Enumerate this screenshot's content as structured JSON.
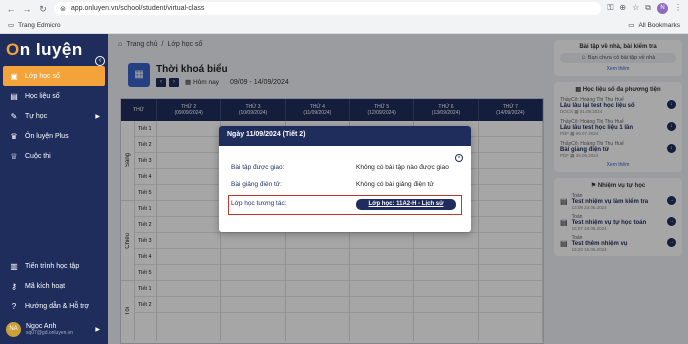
{
  "browser": {
    "url": "app.onluyen.vn/school/student/virtual-class",
    "bookmark": "Trang Edmicro",
    "all_bookmarks": "All Bookmarks",
    "profile_initials": "N"
  },
  "sidebar": {
    "logo_prefix": "O",
    "logo_rest": "n luyện",
    "items": [
      {
        "label": "Lớp học số",
        "icon": "class-icon"
      },
      {
        "label": "Học liệu số",
        "icon": "book-icon"
      },
      {
        "label": "Tự học",
        "icon": "study-icon"
      },
      {
        "label": "Ôn luyện Plus",
        "icon": "trophy-icon"
      },
      {
        "label": "Cuộc thi",
        "icon": "cup-icon"
      }
    ],
    "bottom_items": [
      {
        "label": "Tiến trình học tập",
        "icon": "chart-icon"
      },
      {
        "label": "Mã kích hoạt",
        "icon": "key-icon"
      },
      {
        "label": "Hướng dẫn & Hỗ trợ",
        "icon": "help-icon"
      }
    ],
    "user": {
      "initials": "NA",
      "name": "Ngọc Anh",
      "email": "sq07@gd.onluyen.vn"
    }
  },
  "breadcrumb": {
    "home": "Trang chủ",
    "sep": "/",
    "current": "Lớp học số"
  },
  "timetable": {
    "title": "Thời khoá biểu",
    "today": "Hôm nay",
    "range": "09/09 - 14/09/2024",
    "thu_header": "THỨ",
    "days": [
      {
        "name": "THỨ 2",
        "date": "(09/09/2024)"
      },
      {
        "name": "THỨ 3",
        "date": "(10/09/2024)"
      },
      {
        "name": "THỨ 4",
        "date": "(11/09/2024)"
      },
      {
        "name": "THỨ 5",
        "date": "(12/09/2024)"
      },
      {
        "name": "THỨ 6",
        "date": "(13/09/2024)"
      },
      {
        "name": "THỨ 7",
        "date": "(14/09/2024)"
      }
    ],
    "sessions": [
      "Sáng",
      "Chiều",
      "Tối"
    ],
    "periods": [
      "Tiết 1",
      "Tiết 2",
      "Tiết 3",
      "Tiết 4",
      "Tiết 5",
      "Tiết 1",
      "Tiết 2",
      "Tiết 3",
      "Tiết 4",
      "Tiết 5",
      "Tiết 1",
      "Tiết 2"
    ]
  },
  "right": {
    "homework": {
      "title": "Bài tập về nhà, bài kiểm tra",
      "empty": "Bạn chưa có bài tập về nhà",
      "more": "Xem thêm"
    },
    "materials": {
      "title": "Học liệu số đa phương tiện",
      "items": [
        {
          "teacher": "ThầyCô: Hoàng Thị Thu Huế",
          "name": "Lâu lâu lại test học liệu số",
          "type": "DOCX",
          "date": "01.09.2024"
        },
        {
          "teacher": "ThầyCô: Hoàng Thị Thu Huế",
          "name": "Lâu lâu test học liệu 1 lần",
          "type": "PDF",
          "date": "09.07.2024"
        },
        {
          "teacher": "ThầyCô: Hoàng Thị Thu Huế",
          "name": "Bài giảng điện tử",
          "type": "PDF",
          "date": "26.06.2024"
        }
      ],
      "more": "Xem thêm"
    },
    "tasks": {
      "title": "Nhiệm vụ tự học",
      "items": [
        {
          "subject": "Toán",
          "name": "Test nhiệm vụ làm kiểm tra",
          "date": "13:08 24.06.2024"
        },
        {
          "subject": "Toán",
          "name": "Test nhiệm vụ tự học toán",
          "date": "16:07 18.06.2024"
        },
        {
          "subject": "Toán",
          "name": "Test thêm nhiệm vụ",
          "date": "15:20 15.06.2024"
        }
      ]
    }
  },
  "modal": {
    "title": "Ngày 11/09/2024 (Tiết 2)",
    "homework_label": "Bài tập được giao:",
    "homework_value": "Không có bài tập nào được giao",
    "lecture_label": "Bài giảng điện tử:",
    "lecture_value": "Không có bài giảng điện tử",
    "class_label": "Lớp học tương tác:",
    "class_button": "Lớp học: 11A2-H - Lịch sử"
  }
}
